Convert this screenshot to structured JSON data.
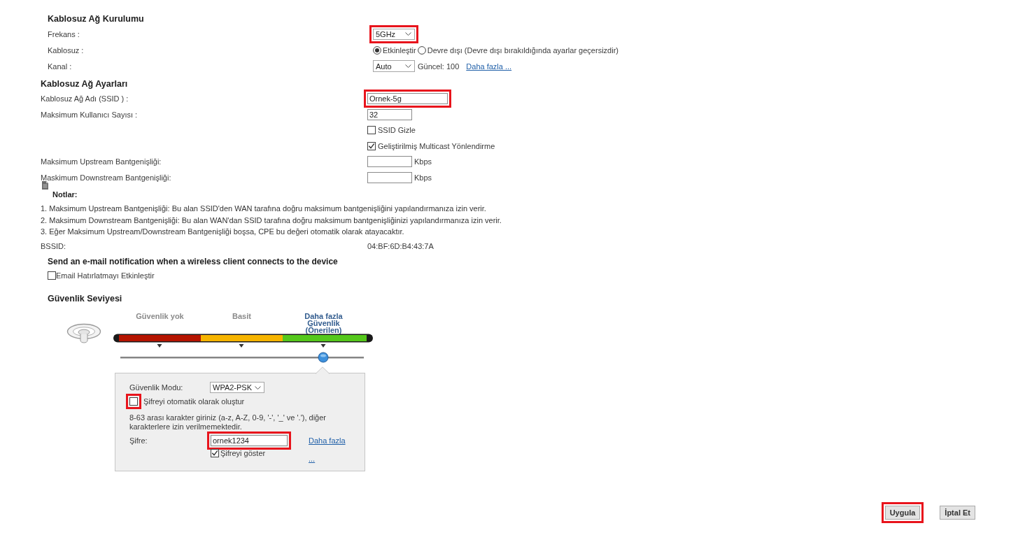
{
  "wireless_setup": {
    "title": "Kablosuz Ağ Kurulumu",
    "frequency": {
      "label": "Frekans :",
      "value": "5GHz",
      "highlighted": true
    },
    "wireless": {
      "label": "Kablosuz :",
      "options": [
        {
          "label": "Etkinleştir",
          "selected": true
        },
        {
          "label": "Devre dışı (Devre dışı bırakıldığında ayarlar geçersizdir)",
          "selected": false
        }
      ]
    },
    "channel": {
      "label": "Kanal :",
      "value": "Auto",
      "current": "Güncel: 100",
      "link": "Daha fazla ..."
    }
  },
  "wireless_settings": {
    "title": "Kablosuz Ağ Ayarları",
    "ssid": {
      "label": "Kablosuz Ağ Adı (SSID ) :",
      "value": "Ornek-5g",
      "highlighted": true
    },
    "max_users": {
      "label": "Maksimum Kullanıcı Sayısı :",
      "value": "32"
    },
    "options": [
      {
        "label": "SSID Gizle",
        "checked": false
      },
      {
        "label": "Geliştirilmiş Multicast Yönlendirme",
        "checked": true
      }
    ],
    "upstream": {
      "label": "Maksimum Upstream Bantgenişliği:",
      "unit": "Kbps"
    },
    "downstream": {
      "label": "Maskimum Downstream Bantgenişliği:",
      "unit": "Kbps"
    },
    "notes_title": "Notlar:",
    "notes": [
      "1. Maksimum Upstream Bantgenişliği: Bu alan SSID'den WAN tarafına doğru maksimum bantgenişliğini yapılandırmanıza izin verir.",
      "2. Maksimum Downstream Bantgenişliği: Bu alan WAN'dan SSID tarafına doğru maksimum bantgenişliğinizi yapılandırmanıza izin verir.",
      "3. Eğer Maksimum Upstream/Downstream Bantgenişliği boşsa, CPE bu değeri otomatik olarak atayacaktır."
    ],
    "bssid": {
      "label": "BSSID:",
      "value": "04:BF:6D:B4:43:7A"
    }
  },
  "email_notification": {
    "title": "Send an e-mail notification when a wireless client connects to the device",
    "option": {
      "label": "Email Hatırlatmayı Etkinleştir",
      "checked": false
    }
  },
  "security": {
    "title": "Güvenlik Seviyesi",
    "levels": [
      {
        "label": "Güvenlik yok",
        "color": "#b51400",
        "selected": false
      },
      {
        "label": "Basit",
        "color": "#f6b400",
        "selected": false
      },
      {
        "label": "Daha fazla Güvenlik (Önerilen)",
        "color": "#55c81c",
        "selected": true
      }
    ],
    "mode": {
      "label": "Güvenlik Modu:",
      "value": "WPA2-PSK"
    },
    "auto_password": {
      "label": "Şifreyi otomatik olarak oluştur",
      "checked": false,
      "highlighted": true
    },
    "hint": "8-63 arası karakter giriniz (a-z, A-Z, 0-9, '-', '_' ve '.'), diğer karakterlere izin verilmemektedir.",
    "password": {
      "label": "Şifre:",
      "value": "ornek1234",
      "highlighted": true
    },
    "link": "Daha fazla ...",
    "show_password": {
      "label": "Şifreyi göster",
      "checked": true
    }
  },
  "buttons": [
    {
      "label": "Uygula",
      "highlighted": true
    },
    {
      "label": "İptal Et",
      "highlighted": false
    }
  ]
}
